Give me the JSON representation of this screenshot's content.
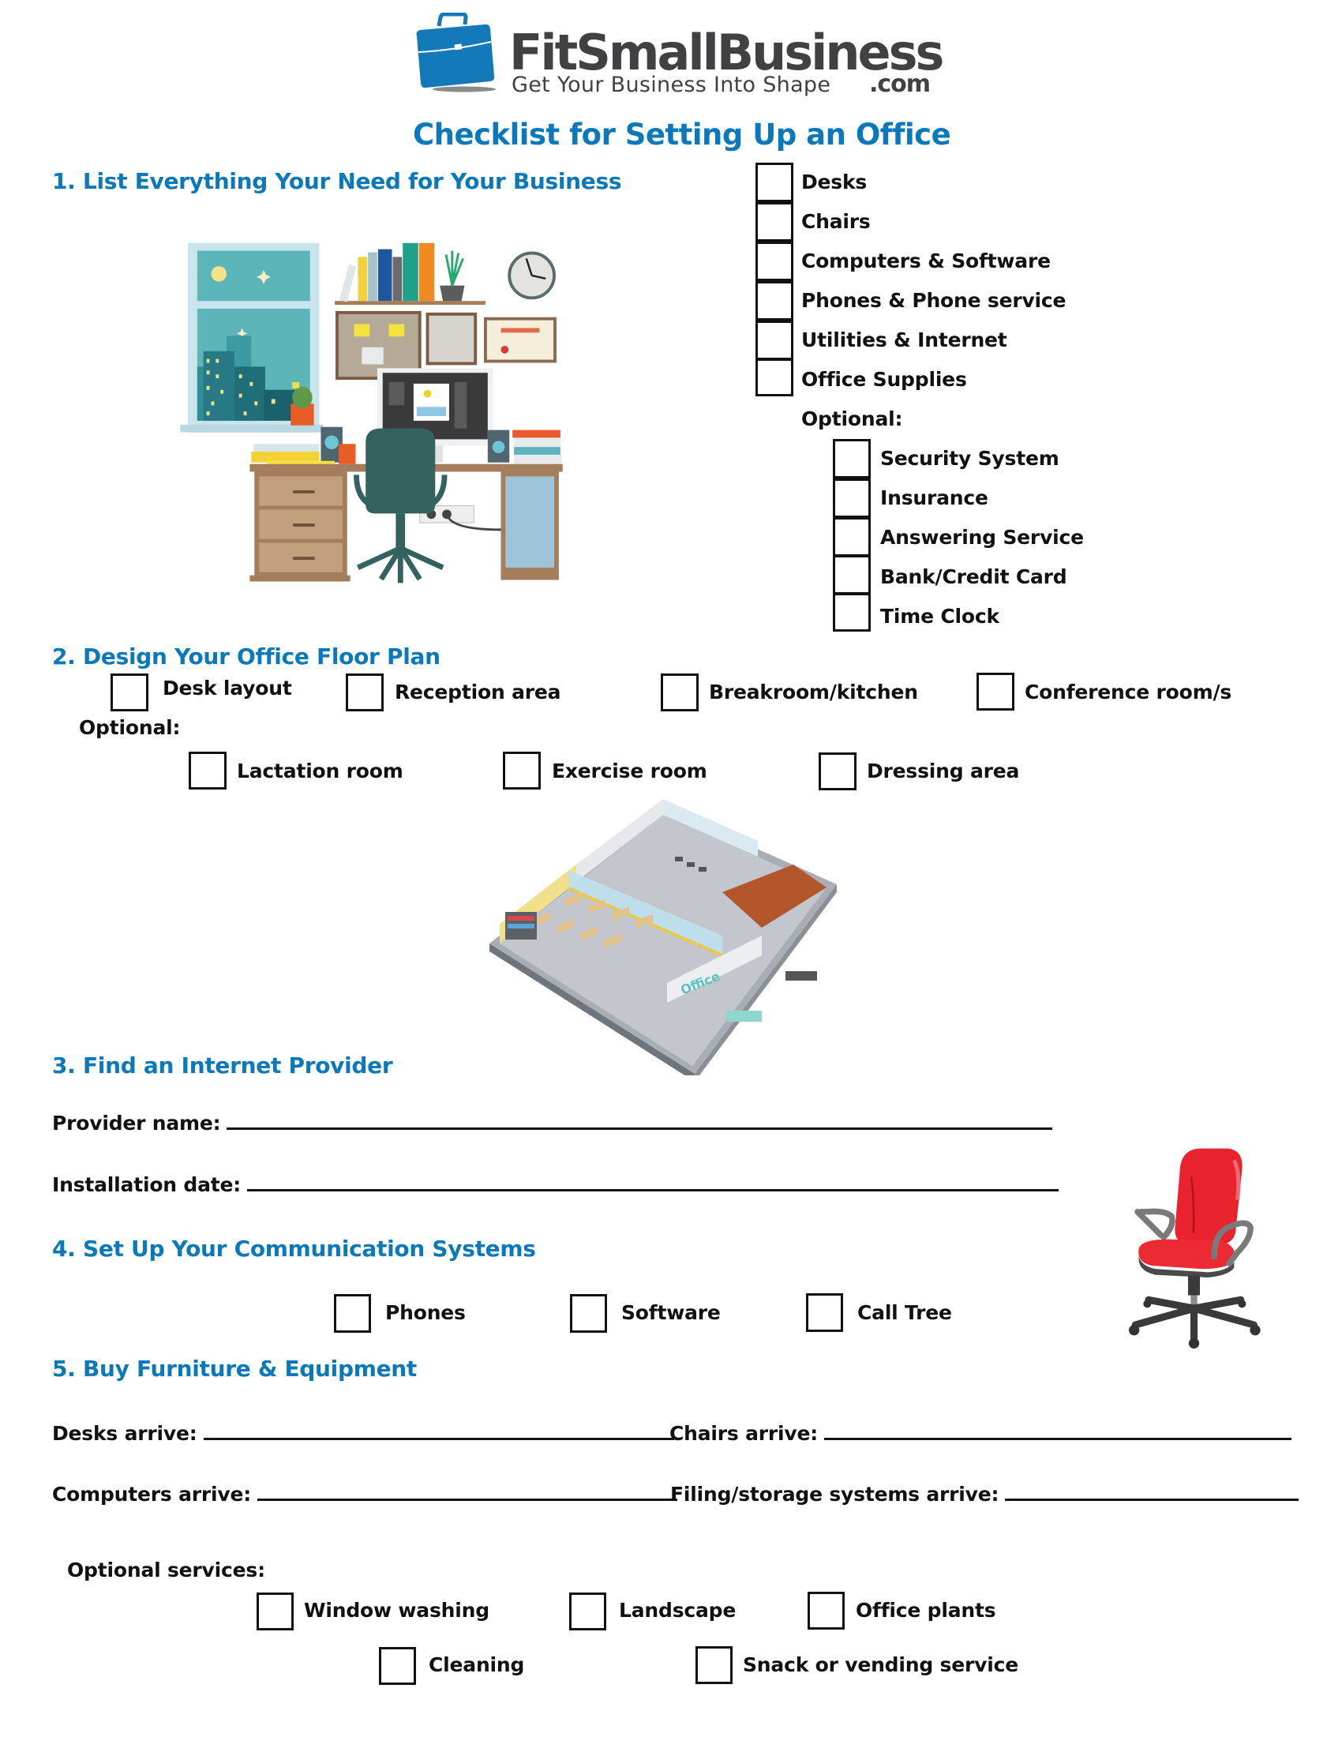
{
  "brand": {
    "name": "FitSmallBusiness",
    "domain_suffix": ".com",
    "tagline": "Get Your Business Into Shape",
    "logo_icon": "briefcase-icon",
    "brand_color": "#0a79bb",
    "text_color": "#414042"
  },
  "document": {
    "title": "Checklist for Setting Up an Office",
    "heading_color": "#0a79bb"
  },
  "sections": {
    "s1": {
      "heading": "1. List Everything Your Need for Your Business",
      "illustration": "home-office-desk-illustration",
      "items": [
        {
          "label": "Desks",
          "checked": false
        },
        {
          "label": "Chairs",
          "checked": false
        },
        {
          "label": "Computers & Software",
          "checked": false
        },
        {
          "label": "Phones & Phone service",
          "checked": false
        },
        {
          "label": "Utilities & Internet",
          "checked": false
        },
        {
          "label": "Office Supplies",
          "checked": false
        }
      ],
      "optional_label": "Optional:",
      "optional_items": [
        {
          "label": "Security System",
          "checked": false
        },
        {
          "label": "Insurance",
          "checked": false
        },
        {
          "label": "Answering Service",
          "checked": false
        },
        {
          "label": "Bank/Credit Card",
          "checked": false
        },
        {
          "label": "Time Clock",
          "checked": false
        }
      ]
    },
    "s2": {
      "heading": "2. Design Your Office Floor Plan",
      "illustration": "isometric-office-floor-plan-illustration",
      "illustration_sign": "Office",
      "items": [
        {
          "label": "Desk layout",
          "checked": false
        },
        {
          "label": "Reception area",
          "checked": false
        },
        {
          "label": "Breakroom/kitchen",
          "checked": false
        },
        {
          "label": "Conference room/s",
          "checked": false
        }
      ],
      "optional_label": "Optional:",
      "optional_items": [
        {
          "label": "Lactation room",
          "checked": false
        },
        {
          "label": "Exercise room",
          "checked": false
        },
        {
          "label": "Dressing area",
          "checked": false
        }
      ]
    },
    "s3": {
      "heading": "3. Find an Internet Provider",
      "fields": [
        {
          "label": "Provider name:",
          "value": ""
        },
        {
          "label": "Installation date:",
          "value": ""
        }
      ]
    },
    "s4": {
      "heading": "4. Set Up Your Communication Systems",
      "items": [
        {
          "label": "Phones",
          "checked": false
        },
        {
          "label": "Software",
          "checked": false
        },
        {
          "label": "Call Tree",
          "checked": false
        }
      ],
      "illustration": "red-office-chair-illustration"
    },
    "s5": {
      "heading": "5. Buy Furniture & Equipment",
      "fields": [
        {
          "label": "Desks arrive:",
          "value": ""
        },
        {
          "label": "Chairs arrive:",
          "value": ""
        },
        {
          "label": "Computers arrive:",
          "value": ""
        },
        {
          "label": "Filing/storage systems arrive:",
          "value": ""
        }
      ],
      "optional_label": "Optional services:",
      "optional_items": [
        {
          "label": "Window washing",
          "checked": false
        },
        {
          "label": "Landscape",
          "checked": false
        },
        {
          "label": "Office plants",
          "checked": false
        },
        {
          "label": "Cleaning",
          "checked": false
        },
        {
          "label": "Snack or vending service",
          "checked": false
        }
      ]
    }
  }
}
